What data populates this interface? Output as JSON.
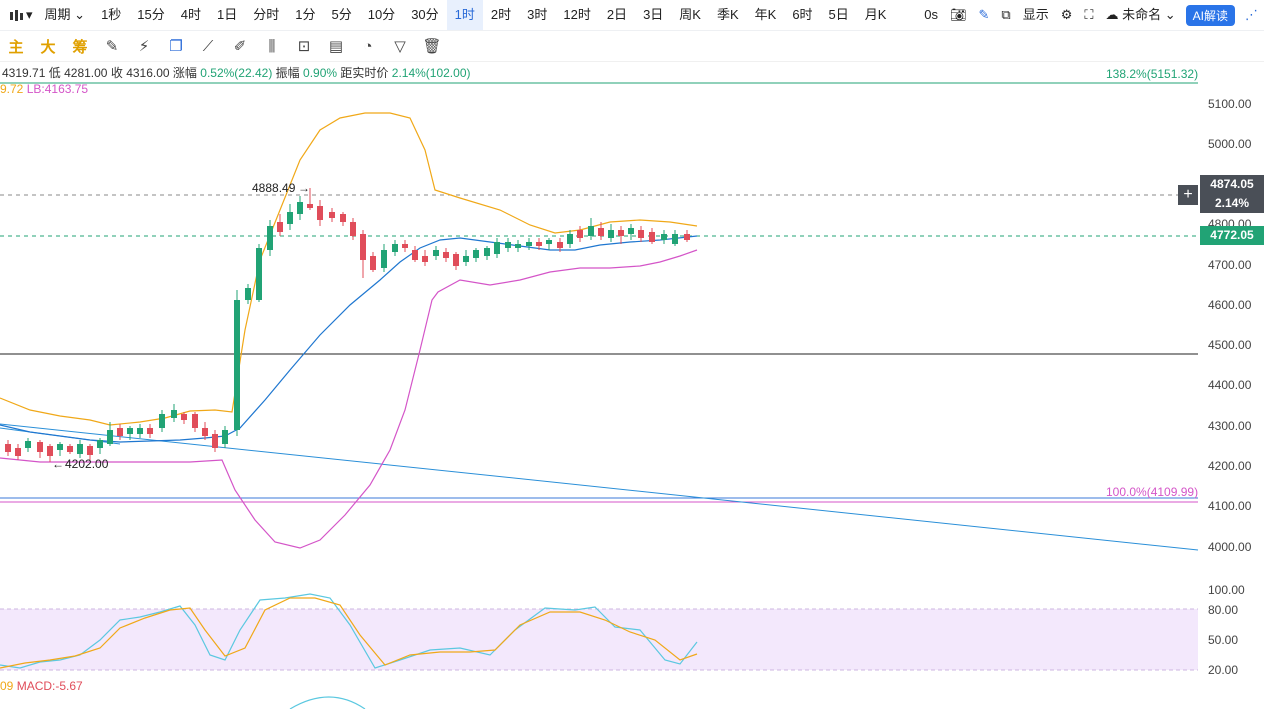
{
  "toolbar": {
    "symbol_icon": "candlestick-icon",
    "period_label": "周期",
    "intervals": [
      "1秒",
      "15分",
      "4时",
      "1日",
      "分时",
      "1分",
      "5分",
      "10分",
      "30分",
      "1时",
      "2时",
      "3时",
      "12时",
      "2日",
      "3日",
      "周K",
      "季K",
      "年K",
      "6时",
      "5日",
      "月K"
    ],
    "active_interval": "1时",
    "right": {
      "timer": "0s",
      "display": "显示",
      "unnamed": "未命名",
      "ai": "AI解读"
    }
  },
  "drawbar": {
    "main": "主",
    "big": "大",
    "chip": "筹"
  },
  "info": {
    "open_high": "4319.71",
    "low_label": "低",
    "low": "4281.00",
    "close_label": "收",
    "close": "4316.00",
    "change_label": "涨幅",
    "change": "0.52%(22.42)",
    "amp_label": "振幅",
    "amp": "0.90%",
    "dist_label": "距实时价",
    "dist": "2.14%(102.00)"
  },
  "boll": {
    "ub": "9.72",
    "lb": "LB:4163.75"
  },
  "fib": {
    "top": "138.2%(5151.32)",
    "bottom": "100.0%(4109.99)"
  },
  "annotations": {
    "high": "4888.49",
    "low": "4202.00"
  },
  "price_axis": [
    "5100.00",
    "5000.00",
    "4900.00",
    "4800.00",
    "4700.00",
    "4600.00",
    "4500.00",
    "4400.00",
    "4300.00",
    "4200.00",
    "4100.00",
    "4000.00"
  ],
  "osc_axis": [
    "100.00",
    "80.00",
    "50.00",
    "20.00"
  ],
  "tags": {
    "marked": "4874.05",
    "marked_pct": "2.14%",
    "current": "4772.05"
  },
  "macd": {
    "prefix": "09",
    "label": "MACD:-5.67"
  },
  "colors": {
    "up": "#21a375",
    "down": "#e04d5a",
    "ub": "#f0a818",
    "mb": "#1f77d0",
    "lb": "#d455c8",
    "current_tag": "#21a375"
  }
}
